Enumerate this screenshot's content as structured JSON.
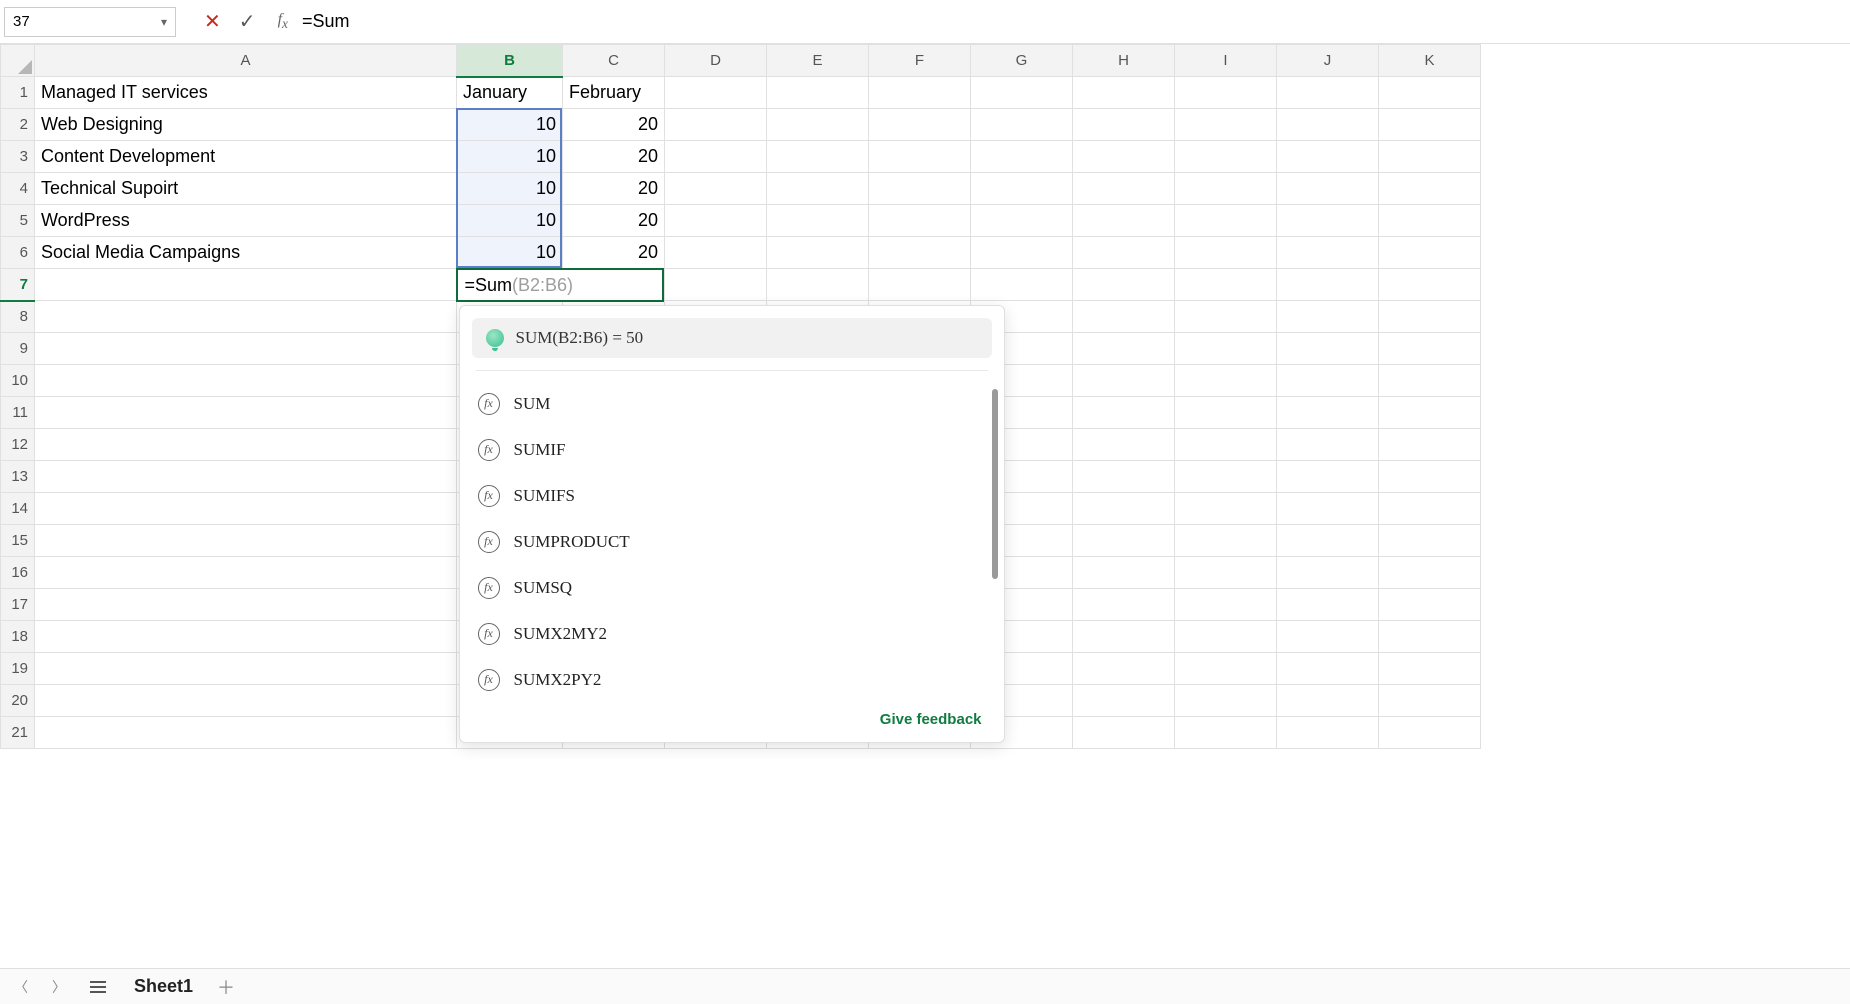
{
  "name_box": "37",
  "formula_bar": "=Sum",
  "columns": [
    "A",
    "B",
    "C",
    "D",
    "E",
    "F",
    "G",
    "H",
    "I",
    "J",
    "K"
  ],
  "rows": [
    {
      "num": "1",
      "a": "Managed IT services",
      "b": "January",
      "c": "February"
    },
    {
      "num": "2",
      "a": "Web Designing",
      "b": "10",
      "c": "20"
    },
    {
      "num": "3",
      "a": "Content Development",
      "b": "10",
      "c": "20"
    },
    {
      "num": "4",
      "a": "Technical Supoirt",
      "b": "10",
      "c": "20"
    },
    {
      "num": "5",
      "a": "WordPress",
      "b": "10",
      "c": "20"
    },
    {
      "num": "6",
      "a": "Social Media Campaigns",
      "b": "10",
      "c": "20"
    }
  ],
  "active_row": "7",
  "active_cell": {
    "typed": "=Sum",
    "ghost": "(B2:B6)"
  },
  "extra_rows": [
    "8",
    "9",
    "10",
    "11",
    "12",
    "13",
    "14",
    "15",
    "16",
    "17",
    "18",
    "19",
    "20",
    "21"
  ],
  "autocomplete": {
    "hint": "SUM(B2:B6)  =  50",
    "items": [
      "SUM",
      "SUMIF",
      "SUMIFS",
      "SUMPRODUCT",
      "SUMSQ",
      "SUMX2MY2",
      "SUMX2PY2"
    ],
    "feedback": "Give feedback"
  },
  "sheet_tab": "Sheet1"
}
